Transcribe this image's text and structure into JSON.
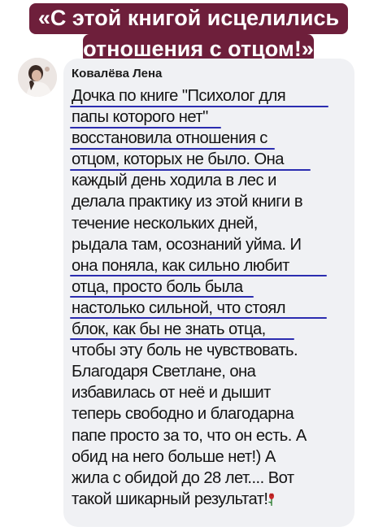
{
  "banner": {
    "line1": "«С этой книгой исцелились",
    "line2": "отношения с отцом!»",
    "color": "#6e1f3b"
  },
  "comment": {
    "author": "Ковалёва Лена",
    "avatar_icon": "profile-photo",
    "lines": [
      "Дочка по книге \"Психолог для",
      "папы которого нет\"",
      "восстановила отношения с",
      "отцом, которых не было. Она",
      "каждый день ходила в лес и",
      "делала практику из этой книги в",
      "течение нескольких дней,",
      "рыдала там, осознаний уйма. И",
      "она поняла, как сильно любит",
      "отца, просто боль была",
      "настолько сильной, что стоял",
      "блок, как бы не знать отца,",
      "чтобы эту боль не чувствовать.",
      "Благодаря Светлане, она",
      "избавилась от неё и дышит",
      "теперь свободно и благодарна",
      "папе просто за то, что он есть. А",
      "обид на него больше нет!) А",
      "жила с обидой до 28 лет.... Вот",
      "такой шикарный результат!"
    ],
    "end_icon": "rose-icon",
    "underline_color": "#2b2db0"
  }
}
